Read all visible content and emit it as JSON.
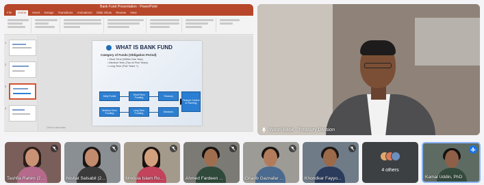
{
  "powerpoint": {
    "window_title": "Bank Fund Presentation - PowerPoint",
    "tabs": [
      "File",
      "Home",
      "Insert",
      "Design",
      "Transitions",
      "Animations",
      "Slide Show",
      "Review",
      "View"
    ],
    "active_tab": "Home",
    "slide_numbers": [
      "1",
      "2",
      "3",
      "4"
    ],
    "notes_placeholder": "Click to add notes"
  },
  "slide": {
    "title": "WHAT IS BANK FUND",
    "category_heading": "Category of Funds (Obligation Period)",
    "bullets": [
      "Short Term (Within One Year)",
      "Medium Term (Two to Five Years)",
      "Long Term (Five Years +)"
    ],
    "boxes": {
      "daily_funds": "Daily Funds",
      "short_term": "Short Term Funding",
      "treasury": "Treasury",
      "medium_term": "Medium Term Funding",
      "long_term": "Long Term Funding",
      "sessions": "Sessions",
      "finance_control": "Finance Control & Planning"
    }
  },
  "speaker": {
    "name_label": "Woori Bank - Treasury Division"
  },
  "participants": [
    {
      "name": "Tashfia Rahim (2...",
      "muted": true
    },
    {
      "name": "Nishat Salsabil (2...",
      "muted": true
    },
    {
      "name": "Mridula Islam Ro...",
      "muted": true
    },
    {
      "name": "Ahmed Fardeen ...",
      "muted": true
    },
    {
      "name": "Gharib Gaznafar ...",
      "muted": true
    },
    {
      "name": "Khondkar Fayyo...",
      "muted": true
    }
  ],
  "others": {
    "label": "4 others"
  },
  "active_participant": {
    "name": "Kamal Uddin, PhD"
  },
  "colors": {
    "powerpoint_accent": "#b7472a",
    "slide_box": "#2e7fd0",
    "speaking_indicator": "#1a73e8"
  }
}
